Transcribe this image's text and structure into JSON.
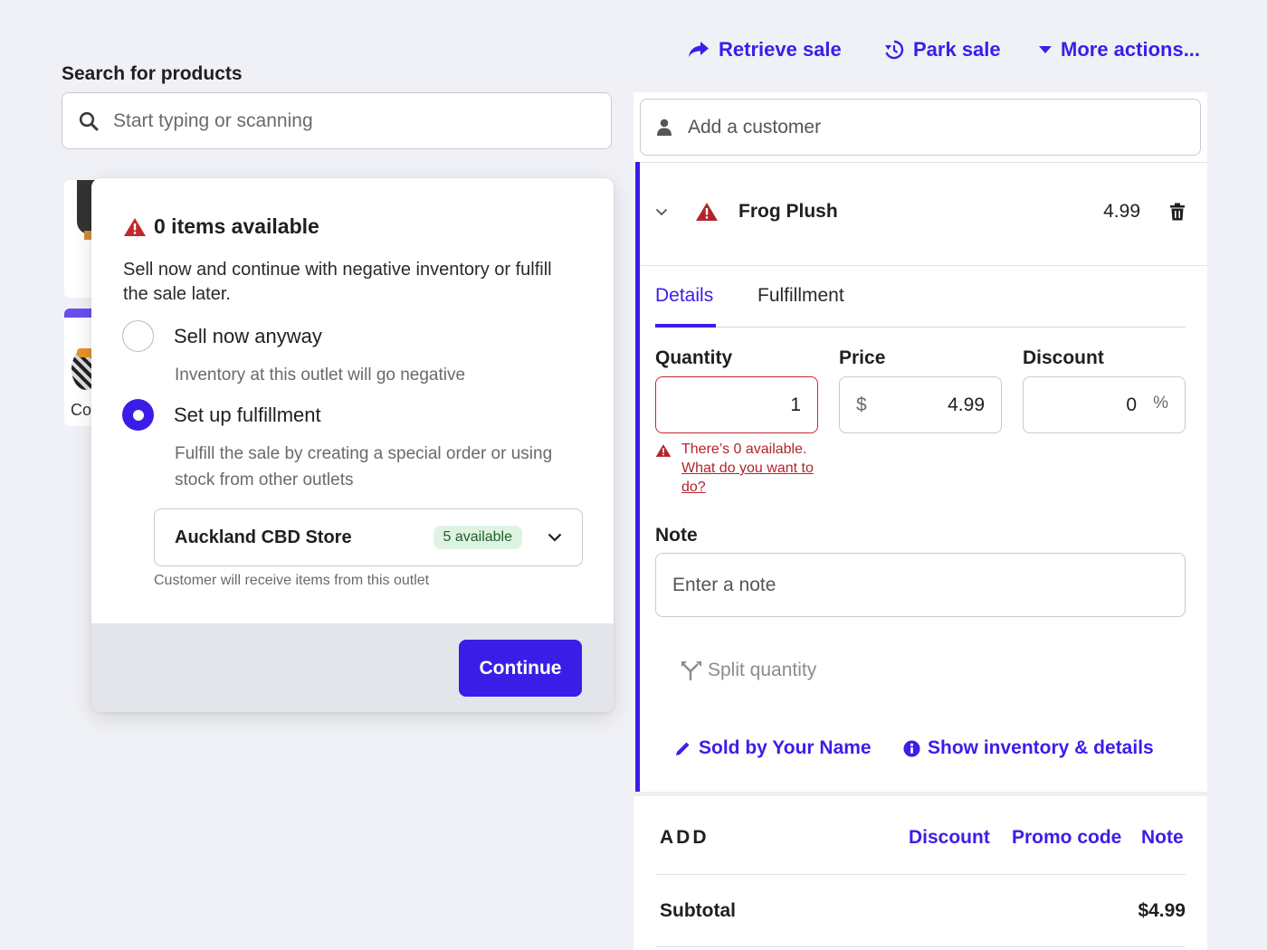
{
  "header": {
    "retrieve_sale": "Retrieve sale",
    "park_sale": "Park sale",
    "more_actions": "More actions..."
  },
  "search": {
    "label": "Search for products",
    "placeholder": "Start typing or scanning"
  },
  "product_tiles": [
    {
      "label": ""
    },
    {
      "label": "Co"
    }
  ],
  "popup": {
    "title": "0 items available",
    "description": "Sell now and continue with negative inventory or fulfill the sale later.",
    "options": [
      {
        "label": "Sell now anyway",
        "sublabel": "Inventory at this outlet will go negative",
        "selected": false
      },
      {
        "label": "Set up fulfillment",
        "sublabel": "Fulfill the sale by creating a special order or using stock from other outlets",
        "selected": true
      }
    ],
    "store_select": {
      "value": "Auckland CBD Store",
      "badge": "5 available",
      "note": "Customer will receive items from this outlet"
    },
    "continue_label": "Continue"
  },
  "customer": {
    "placeholder": "Add a customer"
  },
  "line_item": {
    "name": "Frog Plush",
    "price": "4.99",
    "tabs": [
      "Details",
      "Fulfillment"
    ],
    "active_tab": "Details",
    "quantity_label": "Quantity",
    "quantity_value": "1",
    "price_label": "Price",
    "price_currency": "$",
    "price_value": "4.99",
    "discount_label": "Discount",
    "discount_value": "0",
    "discount_unit": "%",
    "error_text": "There’s 0 available.",
    "error_link": "What do you want to do?",
    "note_label": "Note",
    "note_placeholder": "Enter a note",
    "split_quantity": "Split quantity",
    "sold_by": "Sold by Your Name",
    "show_inventory": "Show inventory & details"
  },
  "add_section": {
    "label": "ADD",
    "discount": "Discount",
    "promo_code": "Promo code",
    "note": "Note"
  },
  "totals": {
    "subtotal_label": "Subtotal",
    "subtotal_value": "$4.99"
  },
  "colors": {
    "accent": "#3a1ee8",
    "error": "#c4282d",
    "badge_bg": "#dff3e2",
    "background": "#f0f1f6"
  }
}
